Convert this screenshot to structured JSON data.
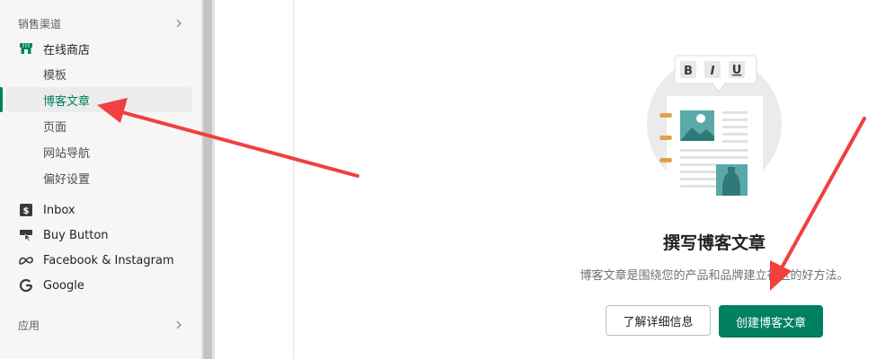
{
  "sidebar": {
    "sales_channels_header": "销售渠道",
    "online_store": {
      "label": "在线商店",
      "icon": "store-icon"
    },
    "online_store_items": [
      {
        "label": "模板",
        "active": false
      },
      {
        "label": "博客文章",
        "active": true
      },
      {
        "label": "页面",
        "active": false
      },
      {
        "label": "网站导航",
        "active": false
      },
      {
        "label": "偏好设置",
        "active": false
      }
    ],
    "channels": [
      {
        "label": "Inbox",
        "icon": "inbox-icon"
      },
      {
        "label": "Buy Button",
        "icon": "buy-button-icon"
      },
      {
        "label": "Facebook & Instagram",
        "icon": "meta-icon"
      },
      {
        "label": "Google",
        "icon": "google-icon"
      }
    ],
    "apps_header": "应用"
  },
  "empty_state": {
    "title": "撰写博客文章",
    "description": "博客文章是围绕您的产品和品牌建立社区的好方法。",
    "secondary_button": "了解详细信息",
    "primary_button": "创建博客文章",
    "illustration": {
      "icon": "blog-post-illustration",
      "toolbar_buttons": [
        "B",
        "I",
        "U"
      ]
    }
  },
  "colors": {
    "accent": "#008060",
    "annotation_arrow": "#f04040",
    "sidebar_bg": "#f6f6f7"
  }
}
